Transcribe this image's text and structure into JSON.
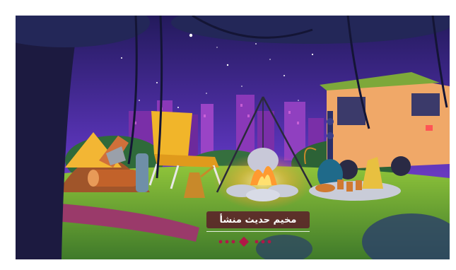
{
  "slide": {
    "caption": "مخيم حديث منشأ",
    "alt_icon": "camping-night-illustration",
    "colors": {
      "caption_bg": "#5a1828",
      "pager_dot": "#b01847",
      "sky_top": "#2a1b6a",
      "sky_bottom": "#7a3ad0"
    }
  },
  "pager": {
    "total": 7,
    "active_index": 3
  }
}
